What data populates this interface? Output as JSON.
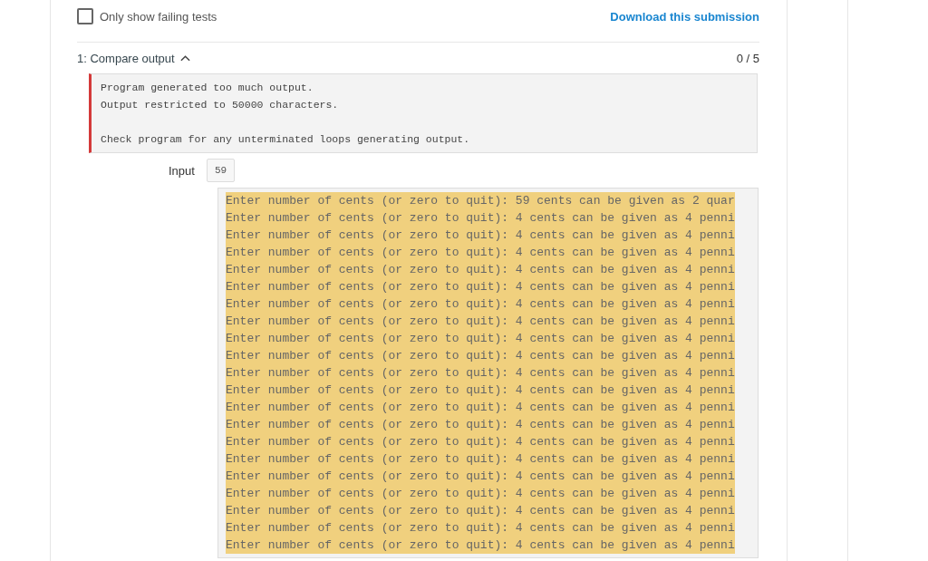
{
  "filter": {
    "label": "Only show failing tests",
    "checked": false
  },
  "download_link": "Download this submission",
  "test": {
    "title": "1: Compare output",
    "expanded": true,
    "score": "0 / 5",
    "error_paragraphs": [
      [
        "Program generated too much output.",
        "Output restricted to 50000 characters."
      ],
      [
        "Check program for any unterminated loops generating output."
      ]
    ],
    "input_label": "Input",
    "input_value": "59",
    "output_lines": [
      {
        "text": "Enter number of cents (or zero to quit): 59 cents can be given as 2 quar",
        "highlighted": true
      },
      {
        "text": "Enter number of cents (or zero to quit): 4 cents can be given as 4 penni",
        "highlighted": true
      },
      {
        "text": "Enter number of cents (or zero to quit): 4 cents can be given as 4 penni",
        "highlighted": true
      },
      {
        "text": "Enter number of cents (or zero to quit): 4 cents can be given as 4 penni",
        "highlighted": true
      },
      {
        "text": "Enter number of cents (or zero to quit): 4 cents can be given as 4 penni",
        "highlighted": true
      },
      {
        "text": "Enter number of cents (or zero to quit): 4 cents can be given as 4 penni",
        "highlighted": true
      },
      {
        "text": "Enter number of cents (or zero to quit): 4 cents can be given as 4 penni",
        "highlighted": true
      },
      {
        "text": "Enter number of cents (or zero to quit): 4 cents can be given as 4 penni",
        "highlighted": true
      },
      {
        "text": "Enter number of cents (or zero to quit): 4 cents can be given as 4 penni",
        "highlighted": true
      },
      {
        "text": "Enter number of cents (or zero to quit): 4 cents can be given as 4 penni",
        "highlighted": true
      },
      {
        "text": "Enter number of cents (or zero to quit): 4 cents can be given as 4 penni",
        "highlighted": true
      },
      {
        "text": "Enter number of cents (or zero to quit): 4 cents can be given as 4 penni",
        "highlighted": true
      },
      {
        "text": "Enter number of cents (or zero to quit): 4 cents can be given as 4 penni",
        "highlighted": true
      },
      {
        "text": "Enter number of cents (or zero to quit): 4 cents can be given as 4 penni",
        "highlighted": true
      },
      {
        "text": "Enter number of cents (or zero to quit): 4 cents can be given as 4 penni",
        "highlighted": true
      },
      {
        "text": "Enter number of cents (or zero to quit): 4 cents can be given as 4 penni",
        "highlighted": true
      },
      {
        "text": "Enter number of cents (or zero to quit): 4 cents can be given as 4 penni",
        "highlighted": true
      },
      {
        "text": "Enter number of cents (or zero to quit): 4 cents can be given as 4 penni",
        "highlighted": true
      },
      {
        "text": "Enter number of cents (or zero to quit): 4 cents can be given as 4 penni",
        "highlighted": true
      },
      {
        "text": "Enter number of cents (or zero to quit): 4 cents can be given as 4 penni",
        "highlighted": true
      },
      {
        "text": "Enter number of cents (or zero to quit): 4 cents can be given as 4 penni",
        "highlighted": true
      }
    ]
  }
}
